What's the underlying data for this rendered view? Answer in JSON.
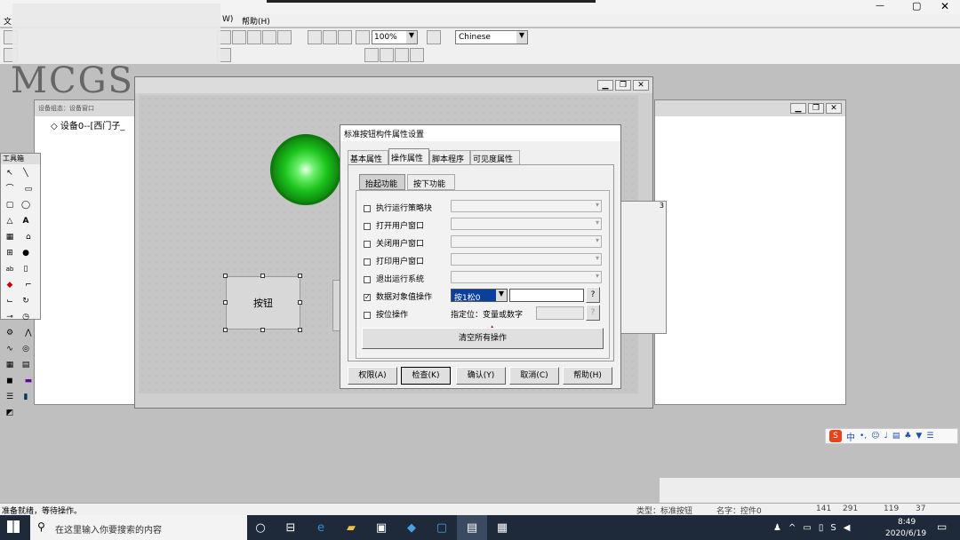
{
  "app": {
    "menu_file": "文",
    "menu_window": "W)",
    "menu_help": "帮助(H)",
    "zoom": "100%",
    "language": "Chinese",
    "logo_text": "MCGS"
  },
  "device_window": {
    "title": "设备组态：设备窗口",
    "tree_item": "设备0--[西门子_"
  },
  "toolbox": {
    "title": "工具箱"
  },
  "canvas": {
    "button_label": "按钮"
  },
  "dialog": {
    "title": "标准按钮构件属性设置",
    "tabs": [
      "基本属性",
      "操作属性",
      "脚本程序",
      "可见度属性"
    ],
    "subtabs": [
      "抬起功能",
      "按下功能"
    ],
    "rows": [
      {
        "label": "执行运行策略块",
        "checked": false
      },
      {
        "label": "打开用户窗口",
        "checked": false
      },
      {
        "label": "关闭用户窗口",
        "checked": false
      },
      {
        "label": "打印用户窗口",
        "checked": false
      },
      {
        "label": "退出运行系统",
        "checked": false
      },
      {
        "label": "数据对象值操作",
        "checked": true
      },
      {
        "label": "按位操作",
        "checked": false
      }
    ],
    "data_op_value": "按1松0",
    "question": "?",
    "assign_label": "指定位：变量或数字",
    "clear_all": "清空所有操作",
    "buttons": [
      "权限(A)",
      "检查(K)",
      "确认(Y)",
      "取消(C)",
      "帮助(H)"
    ]
  },
  "ime": {
    "text": "中"
  },
  "status_bar": {
    "text": "准备就绪，等待操作。",
    "type_label": "类型：标准按钮",
    "name_label": "名字：控件0",
    "n1": "141",
    "n2": "291",
    "n3": "119",
    "n4": "37"
  },
  "taskbar": {
    "search_placeholder": "在这里输入你要搜索的内容",
    "time": "8:49",
    "date": "2020/6/19"
  },
  "colors": {
    "lamp_green": "#1cc41c",
    "selection_blue": "#0a3f9c",
    "taskbar": "#1e2a3a"
  }
}
